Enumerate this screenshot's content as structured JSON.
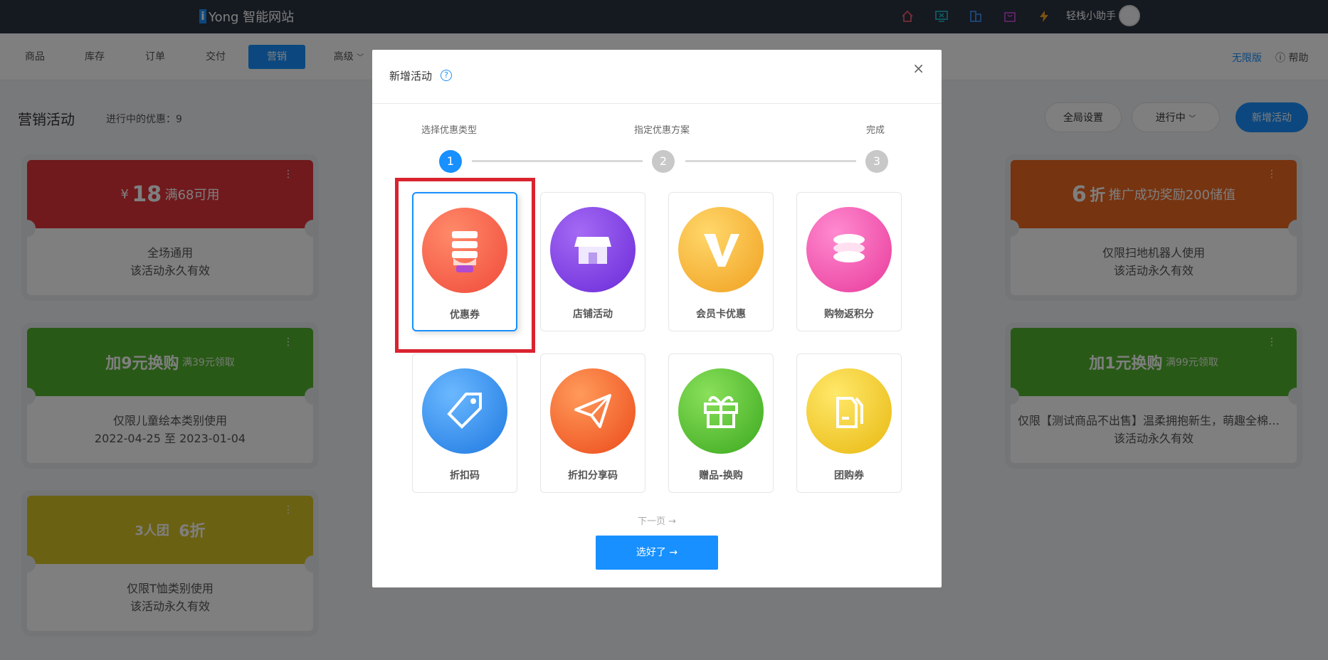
{
  "topbar": {
    "brand_letter": "i",
    "brand_name": "Yong 智能网站",
    "icons": [
      "home-icon",
      "monitor-icon",
      "building-icon",
      "bag-icon",
      "lightning-icon"
    ],
    "assistant": "轻栈小助手"
  },
  "nav": {
    "items": [
      {
        "label": "商品"
      },
      {
        "label": "库存"
      },
      {
        "label": "订单"
      },
      {
        "label": "交付"
      },
      {
        "label": "营销"
      },
      {
        "label": "高级"
      }
    ],
    "edition": "无限版",
    "help": "帮助"
  },
  "page": {
    "title": "营销活动",
    "count": "进行中的优惠：9",
    "global_settings": "全局设置",
    "status_filter": "进行中",
    "add_activity": "新增活动"
  },
  "cards": [
    {
      "color": "#e1343b",
      "price_prefix": "¥",
      "price_value": "18",
      "condition": "满68可用",
      "line1": "全场通用",
      "line2": "该活动永久有效"
    },
    {
      "color": "#ec6922",
      "discount": "6",
      "unit": "折",
      "desc": "推广成功奖励200储值",
      "line1": "仅限扫地机器人使用",
      "line2": "该活动永久有效"
    },
    {
      "color": "#52b32e",
      "title": "加9元换购",
      "condition": "满39元领取",
      "line1": "仅限儿童绘本类别使用",
      "line2": "2022-04-25 至 2023-01-04"
    },
    {
      "color": "#52b32e",
      "title": "加1元换购",
      "condition": "满99元领取",
      "line1": "仅限【测试商品不出售】温柔拥抱新生，萌趣全棉哈衣...",
      "line2": "该活动永久有效"
    },
    {
      "color": "#d6c324",
      "title": "3人团",
      "discount": "6折",
      "line1": "仅限T恤类别使用",
      "line2": "该活动永久有效"
    }
  ],
  "modal": {
    "title": "新增活动",
    "help_symbol": "?",
    "close_symbol": "×",
    "steps": [
      {
        "label": "选择优惠类型",
        "num": "1",
        "active": true
      },
      {
        "label": "指定优惠方案",
        "num": "2",
        "active": false
      },
      {
        "label": "完成",
        "num": "3",
        "active": false
      }
    ],
    "types": [
      {
        "label": "优惠券",
        "icon": "coupon-hand-icon",
        "color": "#f05a4a",
        "selected": true
      },
      {
        "label": "店铺活动",
        "icon": "store-icon",
        "color": "#7b3fe4",
        "selected": false
      },
      {
        "label": "会员卡优惠",
        "icon": "vip-card-icon",
        "color": "#f5b42a",
        "selected": false
      },
      {
        "label": "购物返积分",
        "icon": "points-coins-icon",
        "color": "#f052a8",
        "selected": false
      },
      {
        "label": "折扣码",
        "icon": "tag-icon",
        "color": "#2f8df0",
        "selected": false
      },
      {
        "label": "折扣分享码",
        "icon": "paper-plane-icon",
        "color": "#f06a2a",
        "selected": false
      },
      {
        "label": "赠品-换购",
        "icon": "gift-icon",
        "color": "#5ac23a",
        "selected": false
      },
      {
        "label": "团购券",
        "icon": "group-tags-icon",
        "color": "#f0c81a",
        "selected": false
      }
    ],
    "next_page": "下一页 →",
    "confirm": "选好了 →"
  }
}
